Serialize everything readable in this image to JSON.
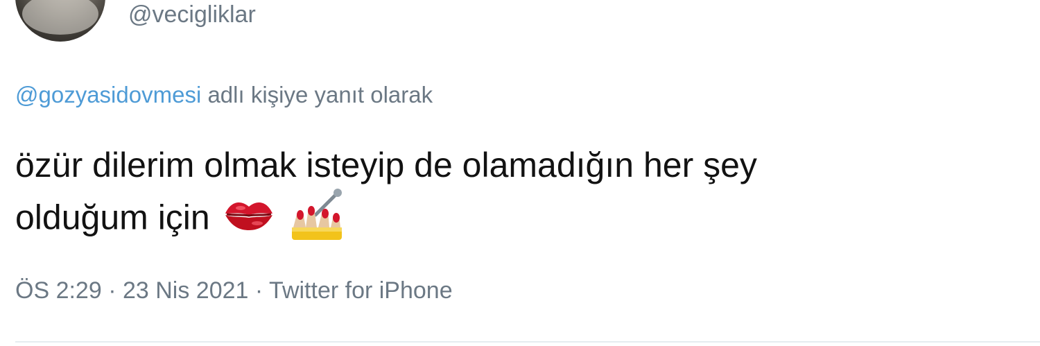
{
  "author": {
    "handle": "@vecigliklar"
  },
  "reply_context": {
    "mention": "@gozyasidovmesi",
    "suffix": " adlı kişiye yanıt olarak"
  },
  "tweet": {
    "line1": "özür dilerim olmak isteyip de olamadığın her şey",
    "line2": "olduğum için",
    "emojis": [
      "kiss-mark-icon",
      "nail-polish-icon"
    ]
  },
  "meta": {
    "time": "ÖS 2:29",
    "date": "23 Nis 2021",
    "source": "Twitter for iPhone",
    "separator": " · "
  },
  "colors": {
    "text": "#121212",
    "secondary": "#6b7884",
    "link": "#4e9bd6",
    "divider": "#e6ecf0"
  }
}
